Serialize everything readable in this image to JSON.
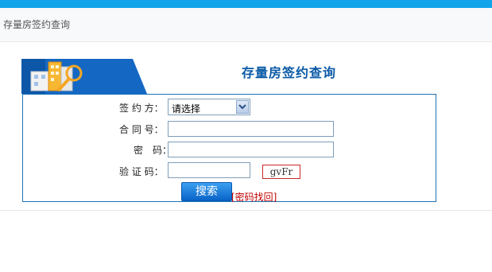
{
  "breadcrumb": "存量房签约查询",
  "banner": {
    "title": "存量房签约查询"
  },
  "form": {
    "signer_label": "签 约 方：",
    "signer_selected": "请选择",
    "contract_label": "合 同 号：",
    "contract_value": "",
    "password_label": "密　码：",
    "password_value": "",
    "verify_label": "验 证 码：",
    "verify_value": "",
    "captcha_text": "gvFr",
    "search_label": "搜索",
    "recover_label": "[密码找回]"
  },
  "colors": {
    "topbar": "#12a4ea",
    "title": "#0a5aa6",
    "box_border": "#1b73b6",
    "link": "#c00000"
  }
}
